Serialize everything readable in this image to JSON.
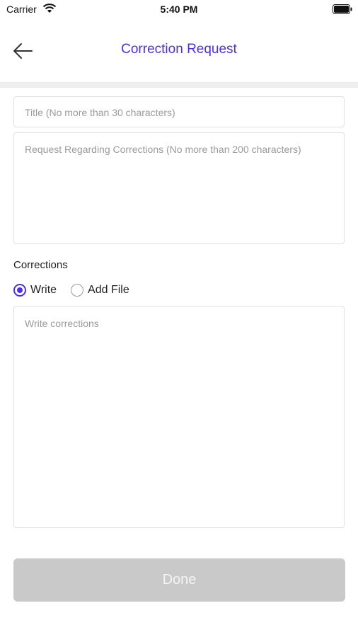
{
  "status_bar": {
    "carrier": "Carrier",
    "time": "5:40 PM"
  },
  "nav": {
    "title": "Correction Request"
  },
  "form": {
    "title_placeholder": "Title (No more than 30 characters)",
    "request_placeholder": "Request Regarding Corrections (No more than 200 characters)",
    "corrections_label": "Corrections",
    "options": [
      {
        "label": "Write",
        "selected": true
      },
      {
        "label": "Add File",
        "selected": false
      }
    ],
    "corrections_placeholder": "Write corrections"
  },
  "done_label": "Done",
  "colors": {
    "accent": "#4a2ff0",
    "disabled_button": "#c9c9c9"
  }
}
